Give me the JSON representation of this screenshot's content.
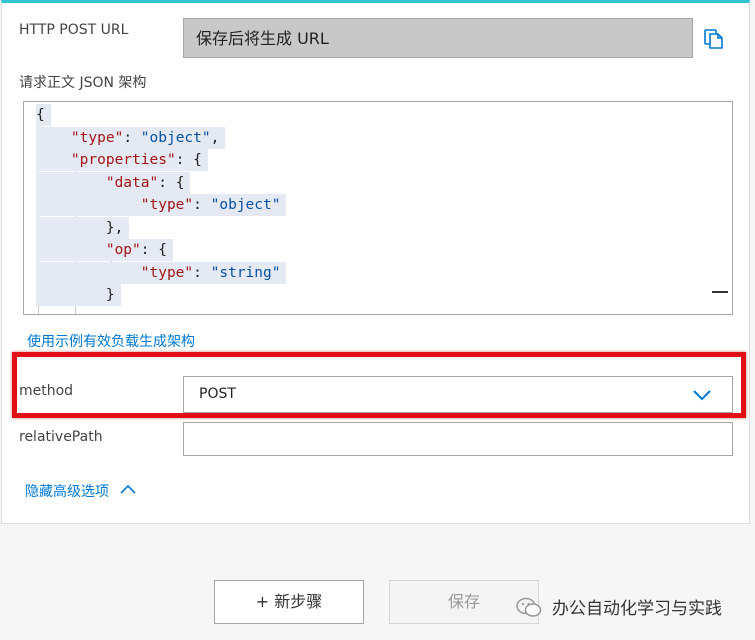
{
  "trigger": {
    "url_label": "HTTP POST URL",
    "url_value": "保存后将生成 URL",
    "schema_label": "请求正文 JSON 架构",
    "schema_lines": [
      "{",
      "    \"type\": \"object\",",
      "    \"properties\": {",
      "        \"data\": {",
      "            \"type\": \"object\"",
      "        },",
      "        \"op\": {",
      "            \"type\": \"string\"",
      "        }"
    ],
    "generate_link": "使用示例有效负载生成架构",
    "method_label": "method",
    "method_value": "POST",
    "relative_path_label": "relativePath",
    "relative_path_value": "",
    "hide_advanced_link": "隐藏高级选项"
  },
  "footer": {
    "new_step_label": "+ 新步骤",
    "save_label": "保存"
  },
  "watermark": {
    "text": "办公自动化学习与实践"
  },
  "colors": {
    "accent": "#0078d4",
    "highlight": "#e21016",
    "top_bar": "#2fc3d4"
  }
}
